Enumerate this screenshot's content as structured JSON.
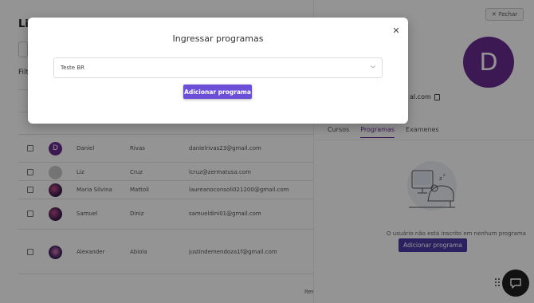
{
  "background_page": {
    "title": "Lis",
    "filter_label": "Filt",
    "rows": [
      {
        "avatar_letter": "D",
        "first": "Daniel",
        "last": "Rivas",
        "email": "danielrivas23@gmail.com"
      },
      {
        "avatar_letter": "",
        "first": "Liz",
        "last": "Cruz",
        "email": "lcruz@zermatusa.com"
      },
      {
        "avatar_letter": "",
        "first": "Maria Silvina",
        "last": "Mattoli",
        "email": "laureanoconsoli021200@gmail.com"
      },
      {
        "avatar_letter": "",
        "first": "Samuel",
        "last": "Diniz",
        "email": "samueldini01@gmail.com"
      },
      {
        "avatar_letter": "",
        "first": "Alexander",
        "last": "Abiola",
        "email": "justindemendoza1f@gmail.com"
      }
    ],
    "items_label": "Iten"
  },
  "panel": {
    "close_label": "Fechar",
    "avatar_letter": "D",
    "email_partial": "al.com",
    "tabs": [
      "Cursos",
      "Programas",
      "Examenes"
    ],
    "active_tab": "Programas",
    "empty_text": "O usuário não está inscrito em nenhum programa",
    "add_button": "Adicionar programa"
  },
  "modal": {
    "title": "Ingressar programas",
    "select_value": "Teste BR",
    "add_button": "Adicionar programa"
  },
  "colors": {
    "accent": "#6a2c91",
    "modal_button": "#6b4fd8",
    "panel_button": "#4b3aa6"
  }
}
